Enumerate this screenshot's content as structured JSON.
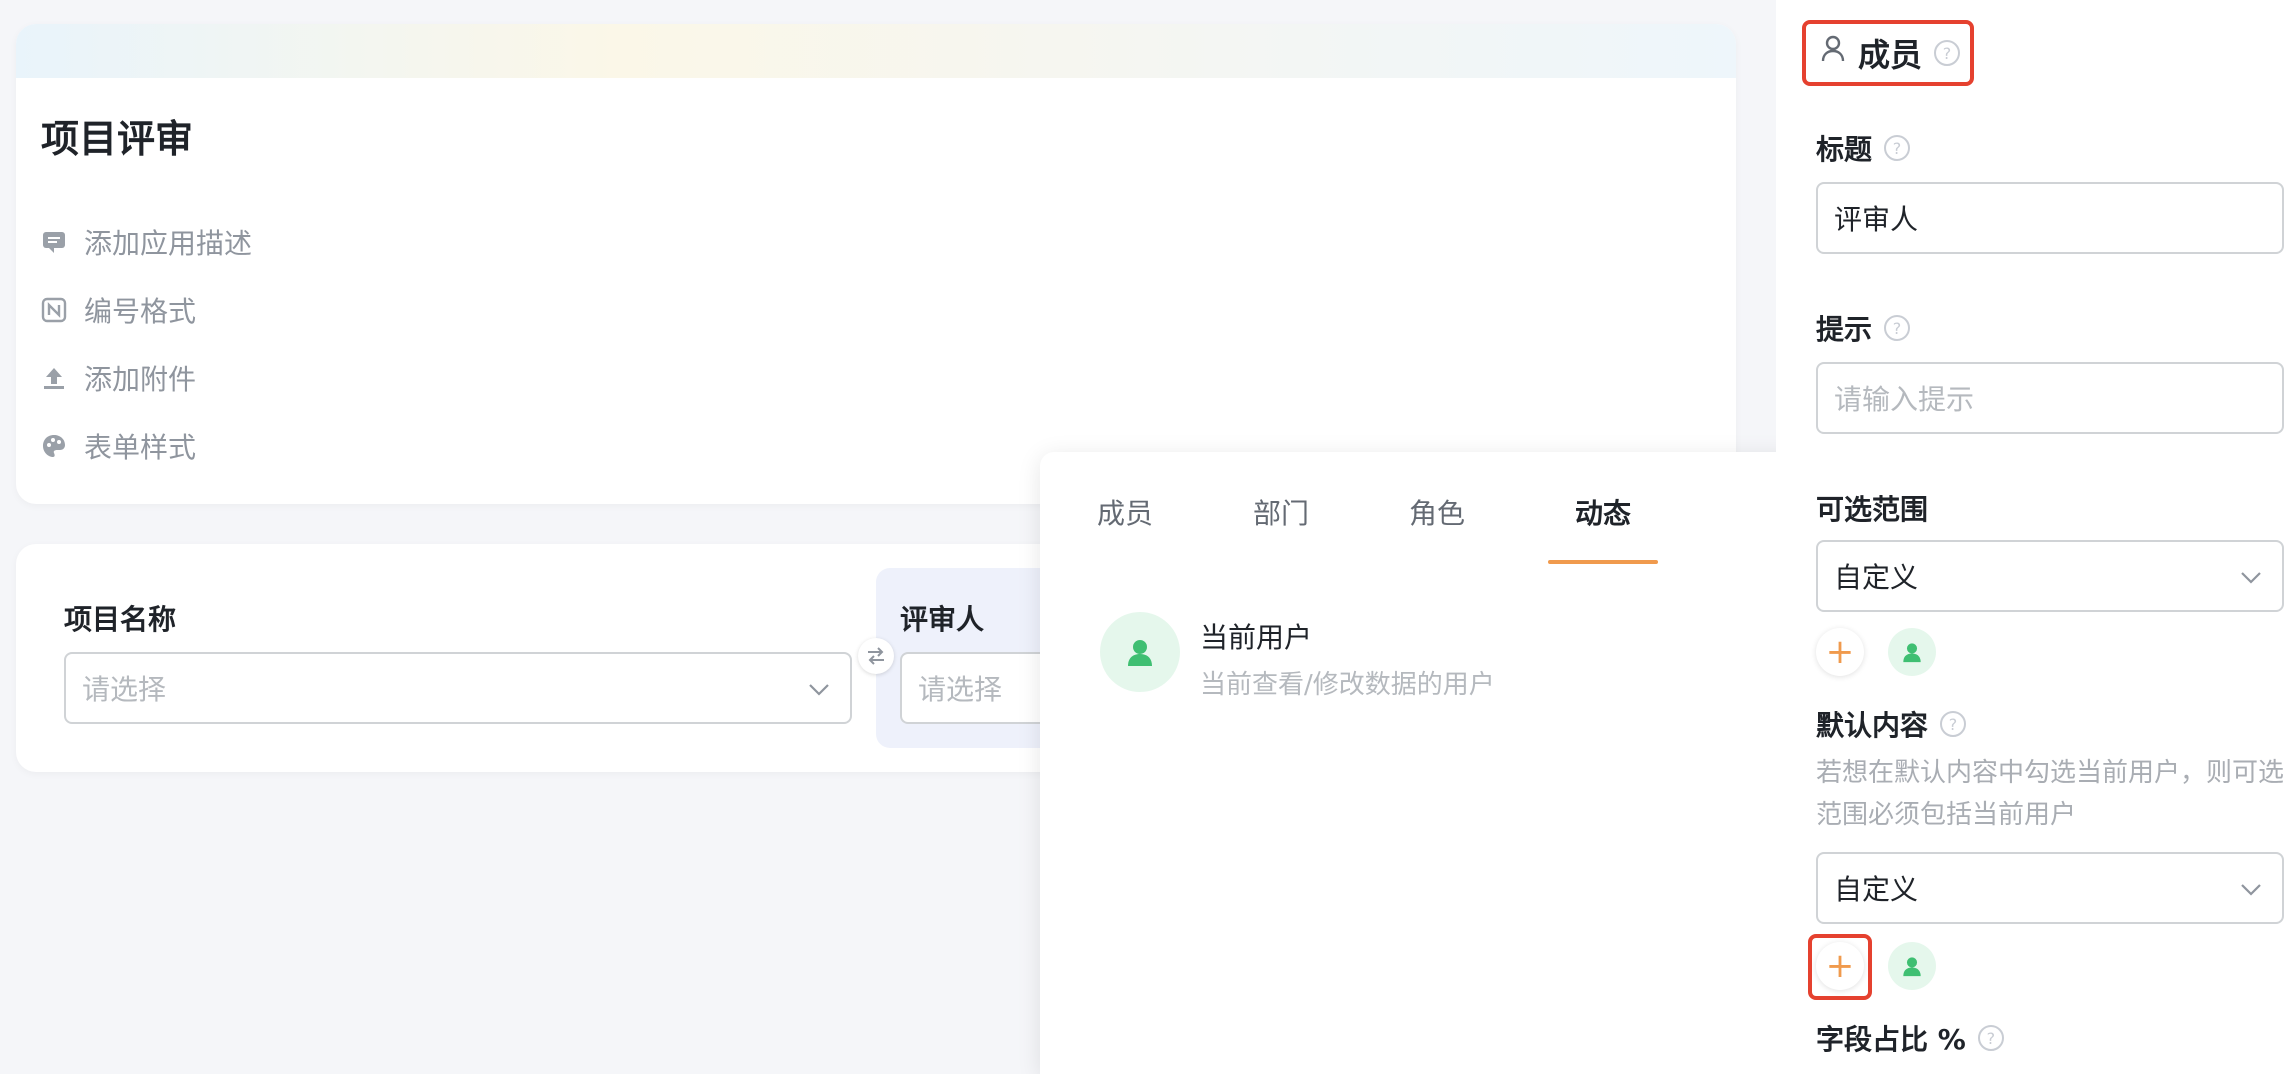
{
  "app": {
    "title": "项目评审",
    "meta": [
      {
        "label": "添加应用描述",
        "icon": "comment-icon"
      },
      {
        "label": "编号格式",
        "icon": "number-format-icon"
      },
      {
        "label": "添加附件",
        "icon": "upload-icon"
      },
      {
        "label": "表单样式",
        "icon": "palette-icon"
      }
    ]
  },
  "form": {
    "project_name": {
      "label": "项目名称",
      "placeholder": "请选择"
    },
    "reviewer": {
      "label": "评审人",
      "placeholder": "请选择"
    }
  },
  "picker": {
    "tabs": [
      "成员",
      "部门",
      "角色",
      "动态"
    ],
    "active_tab": "动态",
    "option": {
      "title": "当前用户",
      "subtitle": "当前查看/修改数据的用户",
      "checked": true
    }
  },
  "panel": {
    "type_label": "成员",
    "title_label": "标题",
    "title_value": "评审人",
    "hint_label": "提示",
    "hint_placeholder": "请输入提示",
    "scope_label": "可选范围",
    "scope_value": "自定义",
    "default_label": "默认内容",
    "default_note": "若想在默认内容中勾选当前用户，则可选范围必须包括当前用户",
    "default_value": "自定义",
    "ratio_label": "字段占比 %"
  },
  "colors": {
    "accent": "#f09a4d",
    "avatar_green": "#3fbf72",
    "highlight": "#e5412f"
  }
}
